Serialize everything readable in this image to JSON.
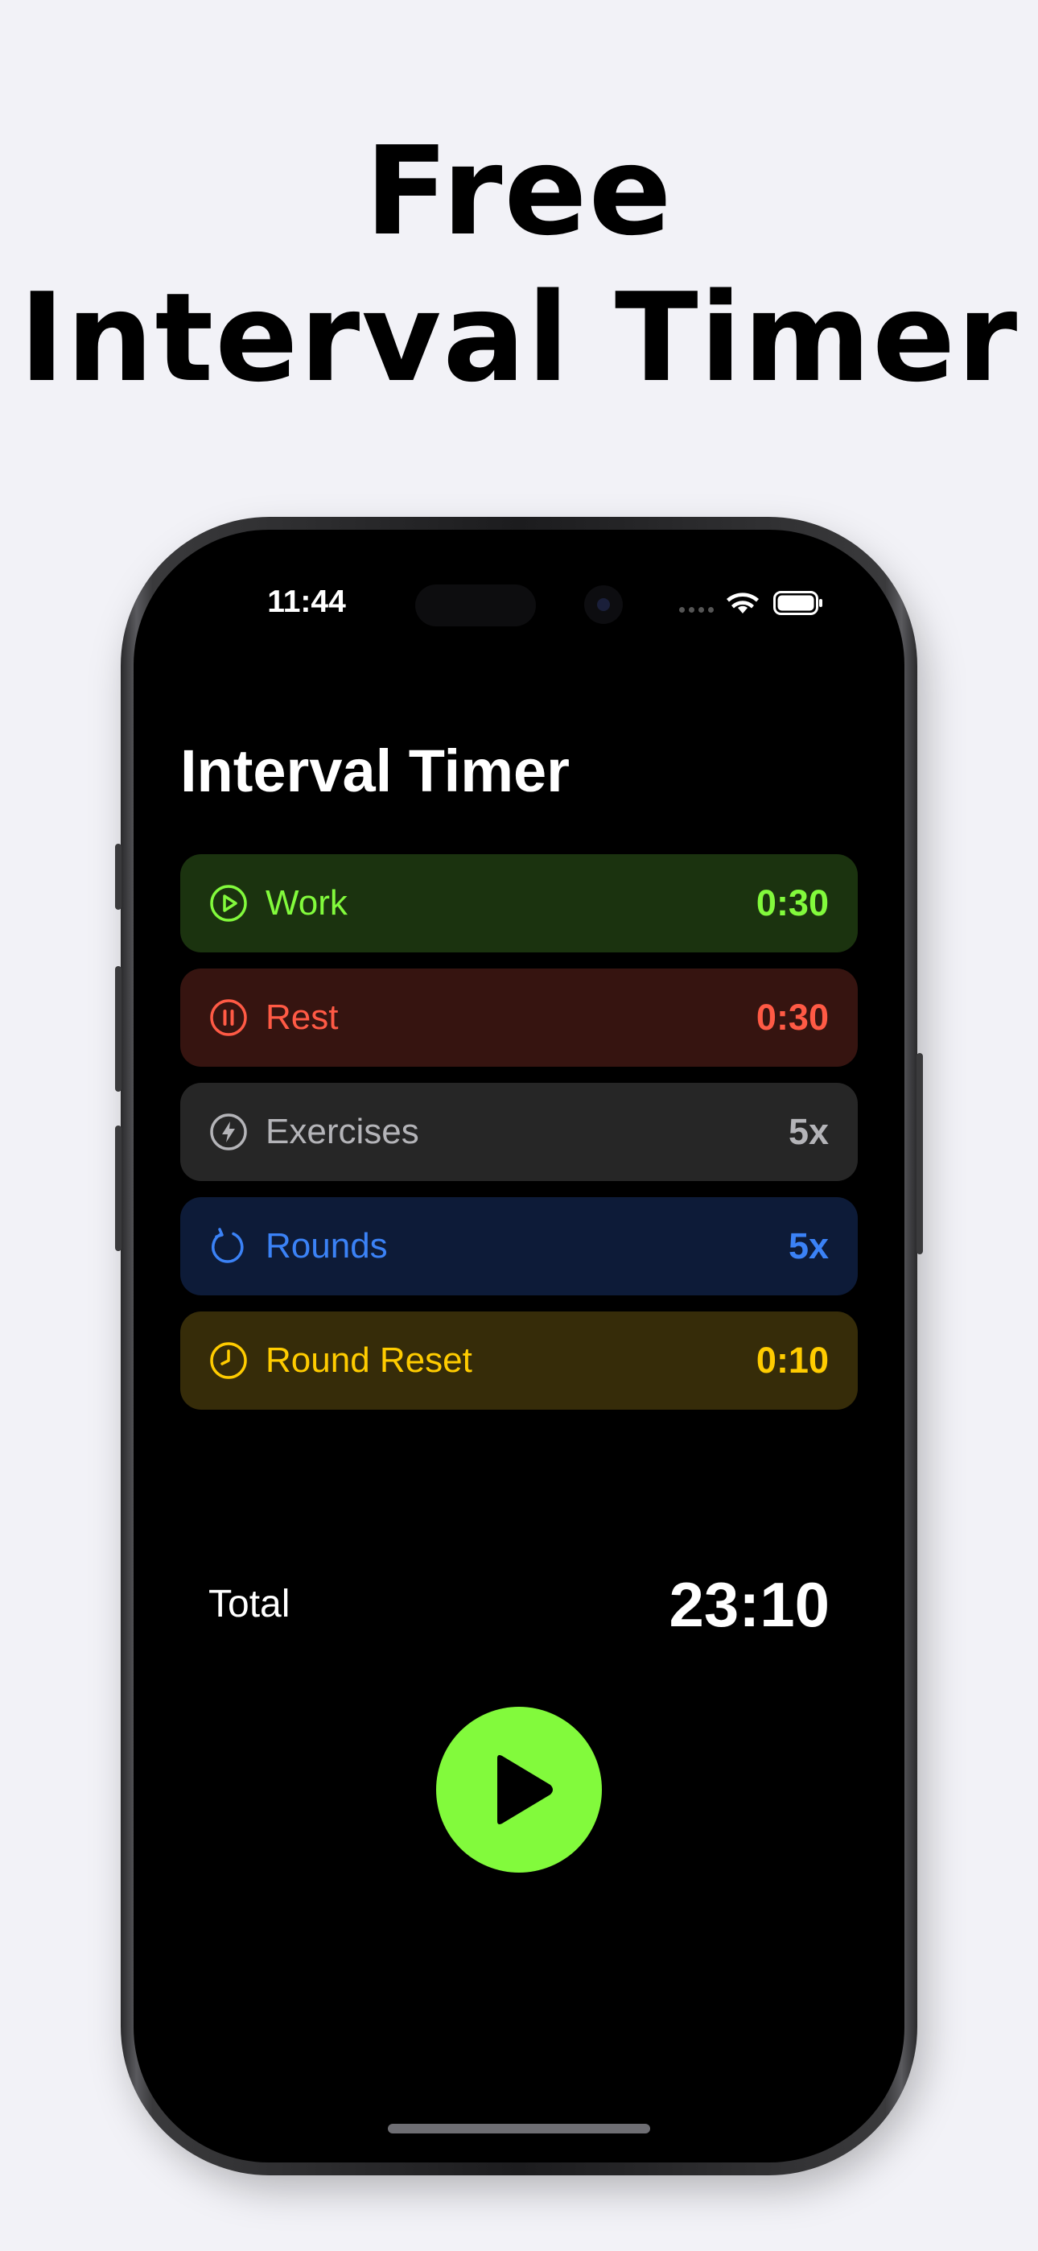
{
  "headline": {
    "line1": "Free",
    "line2": "Interval Timer"
  },
  "status_bar": {
    "time": "11:44",
    "icons": [
      "dynamic-island",
      "camera",
      "signal-dots-icon",
      "wifi-icon",
      "battery-icon"
    ]
  },
  "app": {
    "title": "Interval Timer",
    "rows": [
      {
        "icon": "play-circle-icon",
        "label": "Work",
        "value": "0:30",
        "color": "#82fa3c",
        "bg": "#1b330f"
      },
      {
        "icon": "pause-circle-icon",
        "label": "Rest",
        "value": "0:30",
        "color": "#ff5a45",
        "bg": "#361410"
      },
      {
        "icon": "bolt-circle-icon",
        "label": "Exercises",
        "value": "5x",
        "color": "#b4b4b8",
        "bg": "#262626"
      },
      {
        "icon": "refresh-icon",
        "label": "Rounds",
        "value": "5x",
        "color": "#3b82f6",
        "bg": "#0d1b38"
      },
      {
        "icon": "clock-icon",
        "label": "Round Reset",
        "value": "0:10",
        "color": "#ffcc00",
        "bg": "#362c09"
      }
    ],
    "total": {
      "label": "Total",
      "value": "23:10"
    },
    "play_button": {
      "icon": "play-icon",
      "color": "#82fa3c"
    }
  },
  "colors": {
    "page_background": "#f2f2f7",
    "screen_background": "#000000",
    "accent": "#82fa3c"
  }
}
